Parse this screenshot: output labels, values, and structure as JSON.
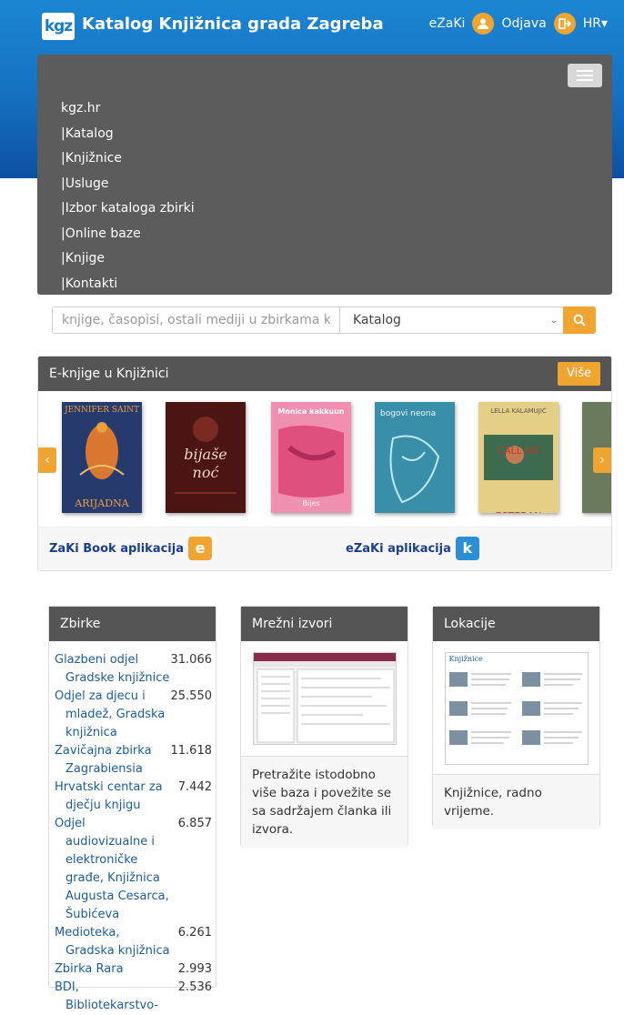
{
  "header": {
    "logo_text": "kgz",
    "title": "Katalog Knjižnica grada Zagreba",
    "ezaki_label": "eZaKi",
    "logout_label": "Odjava",
    "lang_label": "HR▾"
  },
  "nav": {
    "items": [
      "kgz.hr",
      "|Katalog",
      "|Knjižnice",
      "|Usluge",
      "|Izbor kataloga zbirki",
      "|Online baze",
      "|Knjige",
      "|Kontakti"
    ]
  },
  "search": {
    "placeholder": "knjige, časopisi, ostali mediji u zbirkama knjižnic",
    "selected_scope": "Katalog"
  },
  "ebooks": {
    "title": "E-knjige u Knjižnici",
    "more_label": "Više",
    "covers": [
      {
        "top": "JENNIFER SAINT",
        "bottom": "ARIJADNA",
        "bg": "#263a6e",
        "fg": "#e9a13b"
      },
      {
        "top": "",
        "bottom": "bijaše noć",
        "bg": "#4a1512",
        "fg": "#f2d7c4"
      },
      {
        "top": "Monica kakkuun",
        "bottom": "Bijes",
        "bg": "#f08fb0",
        "fg": "#fff"
      },
      {
        "top": "bogovi neona",
        "bottom": "",
        "bg": "#3a8fa8",
        "fg": "#e9f6f8"
      },
      {
        "top": "LELLA KALAMUJIĆ",
        "bottom": "CALL ME ESTEBAN",
        "bg": "#e5cf86",
        "fg": "#b53d2f"
      }
    ],
    "apps": [
      {
        "label": "ZaKi Book aplikacija",
        "icon_color": "#f0a531",
        "icon": "e"
      },
      {
        "label": "eZaKi aplikacija",
        "icon_color": "#2b8fd6",
        "icon": "k"
      }
    ]
  },
  "zbirke": {
    "title": "Zbirke",
    "items": [
      {
        "name": "Glazbeni odjel Gradske knjižnice",
        "count": "31.066"
      },
      {
        "name": "Odjel za djecu i mladež, Gradska knjižnica",
        "count": "25.550"
      },
      {
        "name": "Zavičajna zbirka Zagrabiensia",
        "count": "11.618"
      },
      {
        "name": "Hrvatski centar za dječju knjigu",
        "count": "7.442"
      },
      {
        "name": "Odjel audiovizualne i elektroničke građe, Knjižnica Augusta Cesarca, Šubićeva",
        "count": "6.857"
      },
      {
        "name": "Medioteka, Gradska knjižnica",
        "count": "6.261"
      },
      {
        "name": "Zbirka Rara",
        "count": "2.993"
      },
      {
        "name": "BDI, Bibliotekarstvo-",
        "count": "2.536"
      }
    ]
  },
  "mrezni": {
    "title": "Mrežni izvori",
    "text": "Pretražite istodobno više baza i povežite se sa sadržajem članka ili izvora."
  },
  "lokacije": {
    "title": "Lokacije",
    "text": "Knjižnice, radno vrijeme.",
    "thumb_heading": "Knjižnice"
  }
}
